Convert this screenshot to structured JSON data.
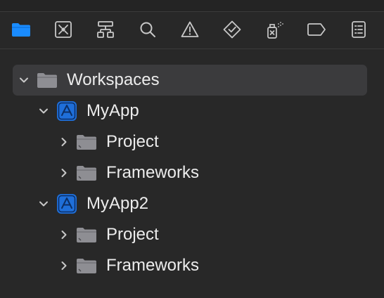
{
  "navigator": {
    "toolbar": {
      "buttons": [
        {
          "icon": "folder-icon",
          "name": "Project navigator",
          "active": true
        },
        {
          "icon": "source-control-icon",
          "name": "Source control navigator"
        },
        {
          "icon": "hierarchy-icon",
          "name": "Symbol navigator"
        },
        {
          "icon": "search-icon",
          "name": "Find navigator"
        },
        {
          "icon": "warning-icon",
          "name": "Issue navigator"
        },
        {
          "icon": "test-diamond-icon",
          "name": "Test navigator"
        },
        {
          "icon": "debug-spray-icon",
          "name": "Debug navigator"
        },
        {
          "icon": "breakpoint-icon",
          "name": "Breakpoint navigator"
        },
        {
          "icon": "report-list-icon",
          "name": "Report navigator"
        }
      ],
      "active_color": "#1a8cff",
      "icon_color": "#c8c8c8"
    },
    "tree": {
      "root": {
        "label": "Workspaces",
        "expanded": true,
        "selected": true
      },
      "apps": [
        {
          "label": "MyApp",
          "expanded": true,
          "children": [
            {
              "label": "Project",
              "expanded": false
            },
            {
              "label": "Frameworks",
              "expanded": false
            }
          ]
        },
        {
          "label": "MyApp2",
          "expanded": true,
          "children": [
            {
              "label": "Project",
              "expanded": false
            },
            {
              "label": "Frameworks",
              "expanded": false
            }
          ]
        }
      ]
    }
  }
}
